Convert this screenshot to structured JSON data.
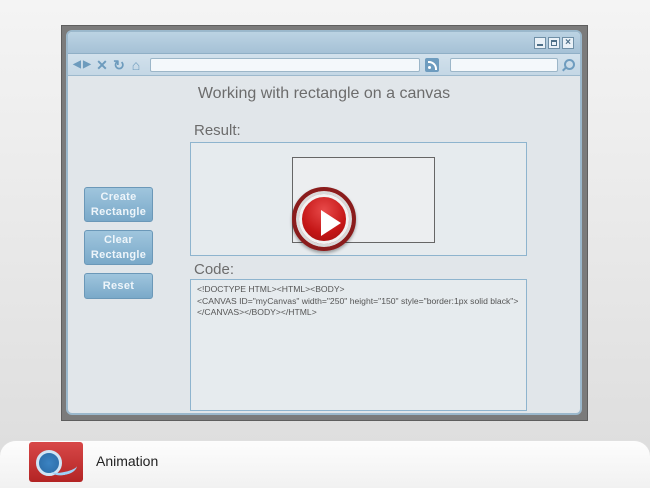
{
  "browser": {
    "nav": {
      "back_glyph": "◀",
      "forward_glyph": "▶",
      "stop_glyph": "✕",
      "refresh_glyph": "↻",
      "home_glyph": "⌂"
    },
    "window_controls": {
      "close_glyph": "×"
    },
    "icons": [
      "minimize-icon",
      "maximize-icon",
      "close-icon",
      "back-icon",
      "forward-icon",
      "stop-icon",
      "refresh-icon",
      "home-icon",
      "rss-icon",
      "search-icon"
    ]
  },
  "page": {
    "title": "Working with rectangle on a canvas",
    "result_label": "Result:",
    "code_label": "Code:",
    "code_lines": [
      "<!DOCTYPE HTML><HTML><BODY>",
      "<CANVAS ID=\"myCanvas\" width=\"250\" height=\"150\" style=\"border:1px solid black\">",
      "</CANVAS></BODY></HTML>"
    ]
  },
  "buttons": {
    "create": "Create Rectangle",
    "clear": "Clear Rectangle",
    "reset": "Reset"
  },
  "footer": {
    "label": "Animation",
    "icon": "animation-film-icon"
  },
  "colors": {
    "button_blue": "#8bb7d4",
    "play_red": "#c41a1a",
    "window_border": "#9bb8cc"
  }
}
